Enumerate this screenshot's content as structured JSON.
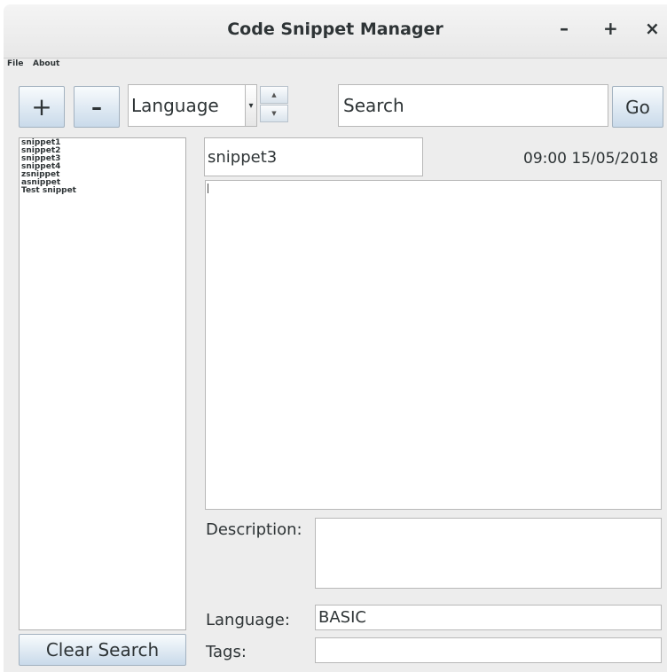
{
  "window": {
    "title": "Code Snippet Manager",
    "minimize": "–",
    "maximize": "+",
    "close": "×"
  },
  "menu": {
    "file": "File",
    "about": "About"
  },
  "toolbar": {
    "add_label": "+",
    "remove_label": "–",
    "language_value": "Language",
    "search_placeholder": "Search",
    "go_label": "Go",
    "spin_up": "▲",
    "spin_down": "▼",
    "dropdown_arrow": "▾"
  },
  "snippets": [
    "snippet1",
    "snippet2",
    "snippet3",
    "snippet4",
    "zsnippet",
    "asnippet",
    "Test snippet"
  ],
  "editor": {
    "name": "snippet3",
    "timestamp": "09:00 15/05/2018",
    "code": "",
    "description_label": "Description:",
    "description": "",
    "language_label": "Language:",
    "language": "BASIC",
    "tags_label": "Tags:",
    "tags": ""
  },
  "clear_search_label": "Clear Search"
}
